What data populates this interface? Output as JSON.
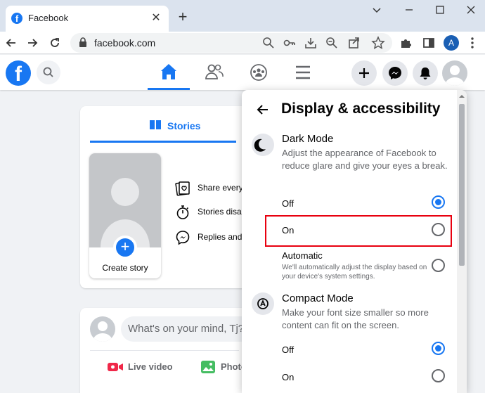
{
  "browser": {
    "tab_title": "Facebook",
    "url": "facebook.com",
    "profile_initial": "A"
  },
  "stories": {
    "tab_label": "Stories",
    "create_story": "Create story",
    "rows": [
      "Share everyone",
      "Stories disap",
      "Replies and"
    ]
  },
  "composer": {
    "placeholder": "What's on your mind, Tj?",
    "actions": [
      "Live video",
      "Photo"
    ]
  },
  "panel": {
    "title": "Display & accessibility",
    "dark_mode": {
      "title": "Dark Mode",
      "description": "Adjust the appearance of Facebook to reduce glare and give your eyes a break.",
      "options": {
        "off": "Off",
        "on": "On",
        "automatic": "Automatic",
        "automatic_desc": "We'll automatically adjust the display based on your device's system settings."
      },
      "selected": "off"
    },
    "compact_mode": {
      "title": "Compact Mode",
      "description": "Make your font size smaller so more content can fit on the screen.",
      "options": {
        "off": "Off",
        "on": "On"
      },
      "selected": "off"
    }
  },
  "colors": {
    "brand": "#1877f2",
    "highlight": "#e8000f",
    "background": "#f0f2f5"
  }
}
